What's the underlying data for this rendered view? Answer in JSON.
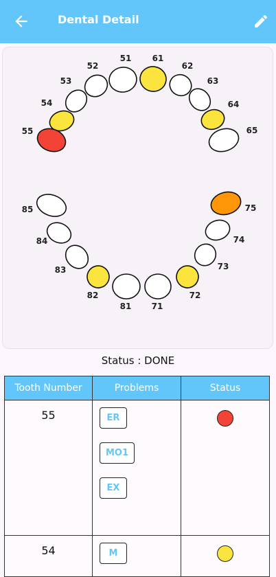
{
  "app_bar": {
    "title": "Dental Detail",
    "back_icon": "arrow-left-icon",
    "edit_icon": "pencil-icon",
    "background": "#63c6fb"
  },
  "status_text": "Status : DONE",
  "legend_colors": {
    "white": "#ffffff",
    "yellow": "#fbe43d",
    "red": "#f34236",
    "orange": "#ff9607"
  },
  "teeth": [
    {
      "number": "51",
      "color": "white"
    },
    {
      "number": "52",
      "color": "white"
    },
    {
      "number": "53",
      "color": "white"
    },
    {
      "number": "54",
      "color": "yellow"
    },
    {
      "number": "55",
      "color": "red"
    },
    {
      "number": "61",
      "color": "yellow"
    },
    {
      "number": "62",
      "color": "white"
    },
    {
      "number": "63",
      "color": "white"
    },
    {
      "number": "64",
      "color": "yellow"
    },
    {
      "number": "65",
      "color": "white"
    },
    {
      "number": "71",
      "color": "white"
    },
    {
      "number": "72",
      "color": "yellow"
    },
    {
      "number": "73",
      "color": "white"
    },
    {
      "number": "74",
      "color": "white"
    },
    {
      "number": "75",
      "color": "orange"
    },
    {
      "number": "81",
      "color": "white"
    },
    {
      "number": "82",
      "color": "yellow"
    },
    {
      "number": "83",
      "color": "white"
    },
    {
      "number": "84",
      "color": "white"
    },
    {
      "number": "85",
      "color": "white"
    }
  ],
  "table": {
    "headers": [
      "Tooth Number",
      "Problems",
      "Status"
    ],
    "rows": [
      {
        "tooth": "55",
        "problems": [
          "ER",
          "MO1",
          "EX"
        ],
        "status_color": "#f34236"
      },
      {
        "tooth": "54",
        "problems": [
          "M"
        ],
        "status_color": "#fbe43d"
      }
    ]
  }
}
